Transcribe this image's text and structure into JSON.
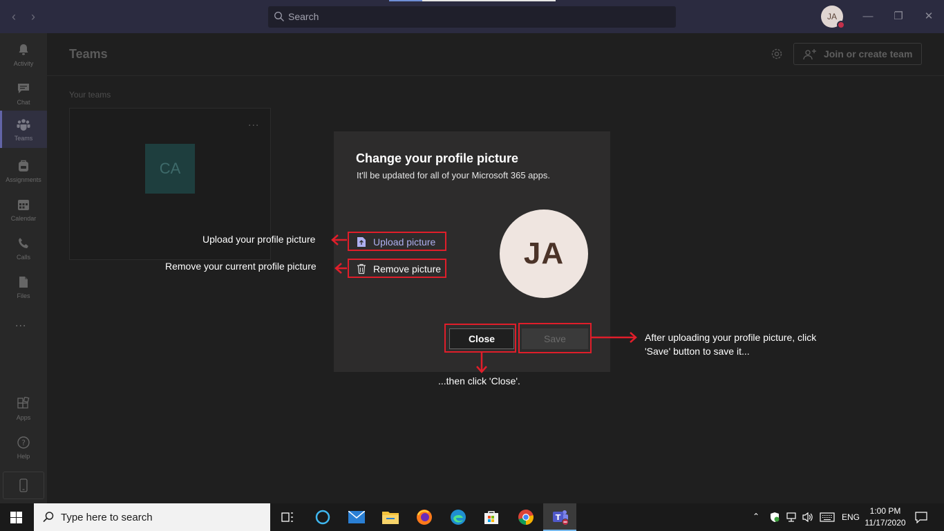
{
  "titlebar": {
    "search_placeholder": "Search",
    "user_initials": "JA"
  },
  "rail": {
    "items": [
      {
        "label": "Activity",
        "icon": "bell-icon"
      },
      {
        "label": "Chat",
        "icon": "chat-icon"
      },
      {
        "label": "Teams",
        "icon": "teams-icon"
      },
      {
        "label": "Assignments",
        "icon": "backpack-icon"
      },
      {
        "label": "Calendar",
        "icon": "calendar-icon"
      },
      {
        "label": "Calls",
        "icon": "phone-icon"
      },
      {
        "label": "Files",
        "icon": "file-icon"
      },
      {
        "label": "Apps",
        "icon": "apps-icon"
      },
      {
        "label": "Help",
        "icon": "help-icon"
      }
    ],
    "more": "...",
    "active": "Teams"
  },
  "main": {
    "title": "Teams",
    "join_label": "Join or create team",
    "your_teams": "Your teams",
    "team_initials": "CA",
    "card_more": "..."
  },
  "dialog": {
    "title": "Change your profile picture",
    "subtitle": "It'll be updated for all of your Microsoft 365 apps.",
    "upload_label": "Upload picture",
    "remove_label": "Remove picture",
    "avatar_initials": "JA",
    "close_label": "Close",
    "save_label": "Save"
  },
  "annotations": {
    "upload": "Upload your profile picture",
    "remove": "Remove your current profile picture",
    "save_line1": "After uploading your profile picture, click",
    "save_line2": "'Save' button to save it...",
    "close": "...then click 'Close'."
  },
  "taskbar": {
    "search_placeholder": "Type here to search",
    "language": "ENG",
    "time": "1:00 PM",
    "date": "11/17/2020"
  },
  "colors": {
    "accent": "#6264a7",
    "annotation": "#e01e2a",
    "dialog_bg": "#2d2c2c",
    "avatar_bg": "#efe5e0"
  }
}
